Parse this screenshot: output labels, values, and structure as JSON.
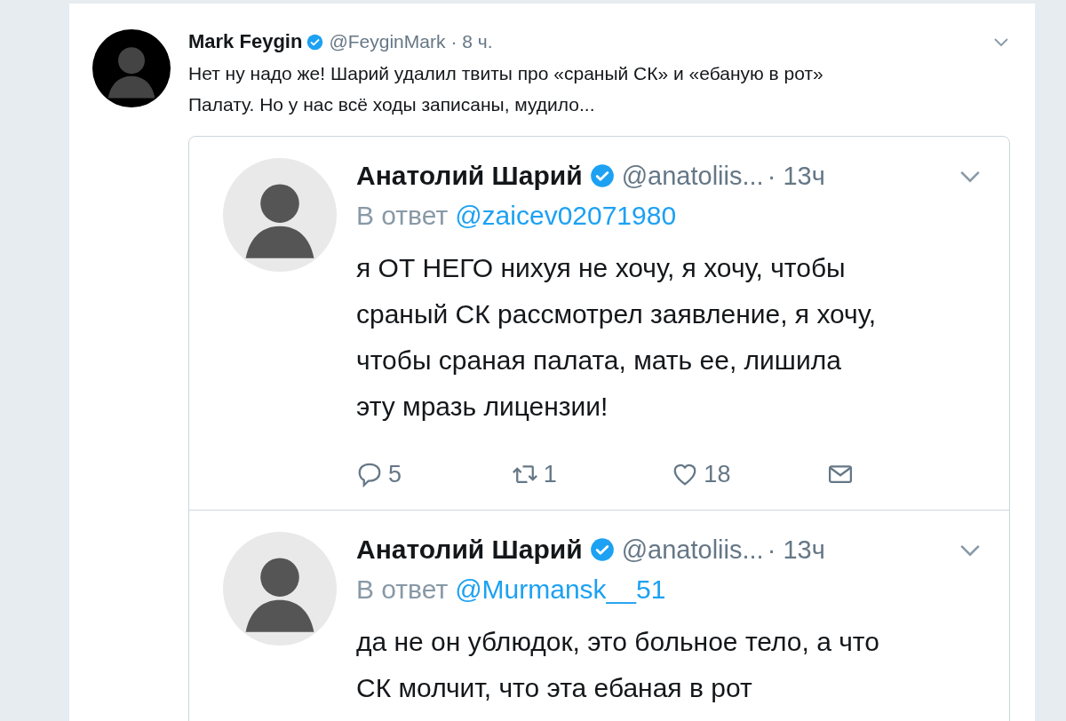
{
  "tweet": {
    "name": "Mark Feygin",
    "verified": true,
    "handle": "@FeyginMark",
    "time": "· 8 ч.",
    "text": "Нет ну надо же! Шарий удалил твиты про «сраный СК» и «ебаную в рот» Палату. Но у нас всё ходы записаны, мудило...",
    "quoted": [
      {
        "name": "Анатолий Шарий",
        "verified": true,
        "handle": "@anatoliis...",
        "time": "· 13ч",
        "reply_prefix": "В ответ",
        "reply_to": "@zaicev02071980",
        "text": "я ОТ НЕГО нихуя не хочу, я хочу, чтобы сраный СК рассмотрел заявление, я хочу, чтобы сраная палата, мать ее, лишила эту мразь лицензии!",
        "actions": [
          {
            "kind": "reply",
            "count": "5"
          },
          {
            "kind": "retweet",
            "count": "1"
          },
          {
            "kind": "like",
            "count": "18"
          },
          {
            "kind": "message"
          }
        ]
      },
      {
        "name": "Анатолий Шарий",
        "verified": true,
        "handle": "@anatoliis...",
        "time": "· 13ч",
        "reply_prefix": "В ответ",
        "reply_to": "@Murmansk__51",
        "text": "да не он ублюдок, это больное тело, а что СК молчит, что эта ебаная в рот"
      }
    ]
  }
}
